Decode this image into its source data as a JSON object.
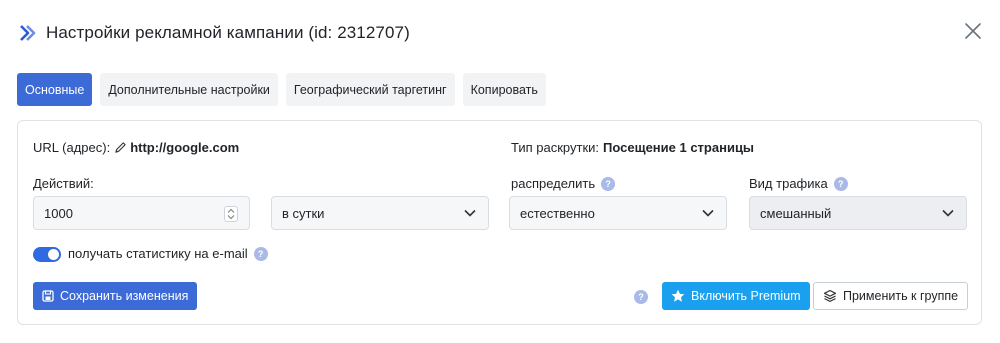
{
  "header": {
    "title": "Настройки рекламной кампании (id: 2312707)"
  },
  "tabs": [
    {
      "label": "Основные",
      "active": true
    },
    {
      "label": "Дополнительные настройки",
      "active": false
    },
    {
      "label": "Географический таргетинг",
      "active": false
    },
    {
      "label": "Копировать",
      "active": false
    }
  ],
  "form": {
    "url_label": "URL (адрес):",
    "url_value": "http://google.com",
    "promo_type_label": "Тип раскрутки:",
    "promo_type_value": "Посещение 1 страницы",
    "actions_label": "Действий:",
    "actions_value": "1000",
    "period_value": "в сутки",
    "distribute_label": "распределить",
    "distribute_value": "естественно",
    "traffic_label": "Вид трафика",
    "traffic_value": "смешанный",
    "email_stats_label": "получать статистику на e-mail",
    "email_stats_enabled": true,
    "help_glyph": "?"
  },
  "buttons": {
    "save": "Сохранить изменения",
    "premium": "Включить Premium",
    "apply_group": "Применить к группе"
  },
  "colors": {
    "primary": "#3c6ad6",
    "info": "#1aa0ee",
    "toggle_on": "#2f6ae0",
    "help_badge": "#a9b9e8"
  }
}
